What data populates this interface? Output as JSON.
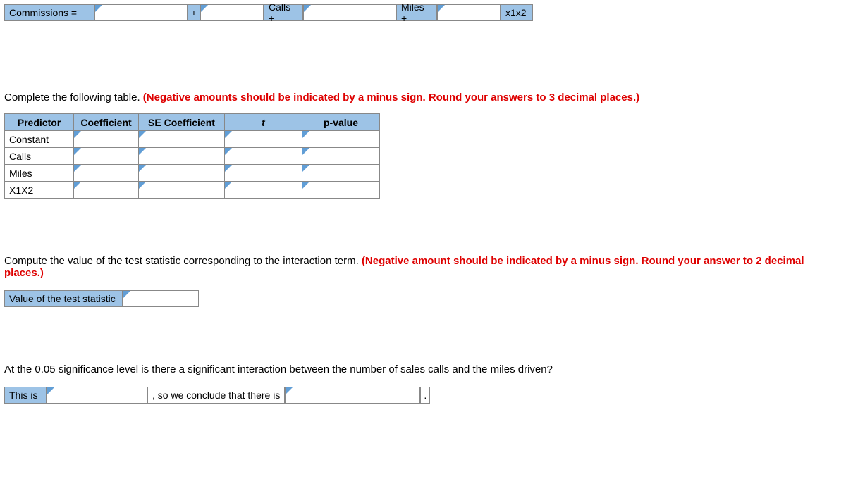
{
  "equation": {
    "commissions_label": "Commissions =",
    "plus": "+",
    "calls_label": "Calls +",
    "miles_label": "Miles +",
    "x1x2_label": "x1x2"
  },
  "table_prompt": {
    "lead": "Complete the following table. ",
    "red": "(Negative amounts should be indicated by a minus sign. Round your answers to 3 decimal places.)"
  },
  "table": {
    "headers": {
      "predictor": "Predictor",
      "coefficient": "Coefficient",
      "se": "SE Coefficient",
      "t": "t",
      "p": "p-value"
    },
    "rows": {
      "constant": "Constant",
      "calls": "Calls",
      "miles": "Miles",
      "x1x2": "X1X2"
    }
  },
  "test_stat_prompt": {
    "lead": "Compute the value of the test statistic corresponding to the interaction term. ",
    "red": "(Negative amount should be indicated by a minus sign. Round your answer to 2 decimal places.)"
  },
  "value_label": "Value of the test statistic",
  "sig_prompt": "At the 0.05 significance level is there a significant interaction between the number of sales calls and the miles driven?",
  "conclusion": {
    "this_is": "This is",
    "so_we": ", so we conclude that there is",
    "period": "."
  }
}
